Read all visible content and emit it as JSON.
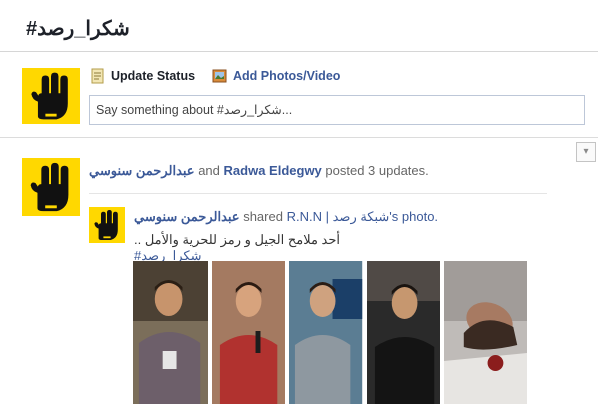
{
  "header": {
    "title": "#شكرا_رصد"
  },
  "composer": {
    "update_status_label": "Update Status",
    "add_photos_label": "Add Photos/Video",
    "input_placeholder": "Say something about #شكرا_رصد...",
    "status_icon": "status-note-icon",
    "photo_icon": "photo-video-icon"
  },
  "feed": {
    "chevron_icon": "chevron-down-icon",
    "story": {
      "author1": "عبدالرحمن سنوسي",
      "connector": "and",
      "author2": "Radwa Eldegwy",
      "summary": "posted 3 updates."
    },
    "substory": {
      "author": "عبدالرحمن سنوسي",
      "shared_text": "shared",
      "page_name": "R.N.N | شبكة رصد",
      "photo_suffix": "'s photo.",
      "caption_text": "أحد ملامح الجيل و رمز للحرية والأمل .. ",
      "caption_hashtag": "#شكرا_رصد"
    },
    "photos": [
      "photo-1",
      "photo-2",
      "photo-3",
      "photo-4",
      "photo-5"
    ]
  },
  "colors": {
    "link_blue": "#3b5998",
    "avatar_yellow": "#ffd800",
    "divider": "#dcdcdc"
  }
}
